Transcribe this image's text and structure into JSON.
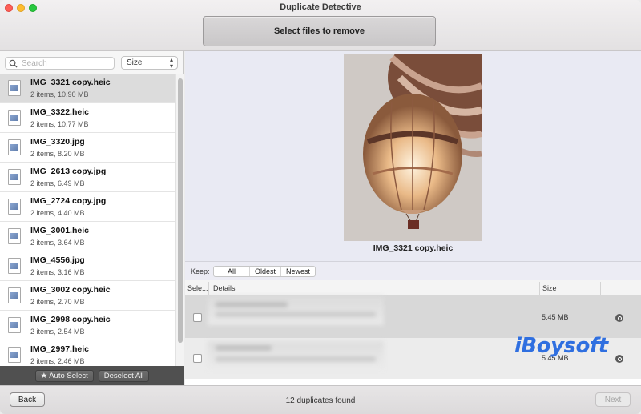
{
  "window": {
    "title": "Duplicate Detective"
  },
  "toolbar": {
    "select_files_label": "Select files to remove"
  },
  "sidebar": {
    "search_placeholder": "Search",
    "sort_value": "Size",
    "auto_select_label": "★ Auto Select",
    "deselect_all_label": "Deselect All",
    "files": [
      {
        "name": "IMG_3321 copy.heic",
        "meta": "2 items, 10.90 MB",
        "selected": true
      },
      {
        "name": "IMG_3322.heic",
        "meta": "2 items, 10.77 MB"
      },
      {
        "name": "IMG_3320.jpg",
        "meta": "2 items, 8.20 MB"
      },
      {
        "name": "IMG_2613 copy.jpg",
        "meta": "2 items, 6.49 MB"
      },
      {
        "name": "IMG_2724 copy.jpg",
        "meta": "2 items, 4.40 MB"
      },
      {
        "name": "IMG_3001.heic",
        "meta": "2 items, 3.64 MB"
      },
      {
        "name": "IMG_4556.jpg",
        "meta": "2 items, 3.16 MB"
      },
      {
        "name": "IMG_3002 copy.heic",
        "meta": "2 items, 2.70 MB"
      },
      {
        "name": "IMG_2998 copy.heic",
        "meta": "2 items, 2.54 MB"
      },
      {
        "name": "IMG_2997.heic",
        "meta": "2 items, 2.46 MB"
      }
    ]
  },
  "preview": {
    "caption": "IMG_3321 copy.heic"
  },
  "keep": {
    "label": "Keep:",
    "options": [
      "All",
      "Oldest",
      "Newest"
    ]
  },
  "table": {
    "headers": {
      "select": "Sele...",
      "details": "Details",
      "size": "Size"
    },
    "rows": [
      {
        "size": "5.45 MB"
      },
      {
        "size": "5.45 MB"
      }
    ]
  },
  "watermark": "iBoysoft",
  "footer": {
    "back_label": "Back",
    "status": "12 duplicates found",
    "next_label": "Next"
  }
}
